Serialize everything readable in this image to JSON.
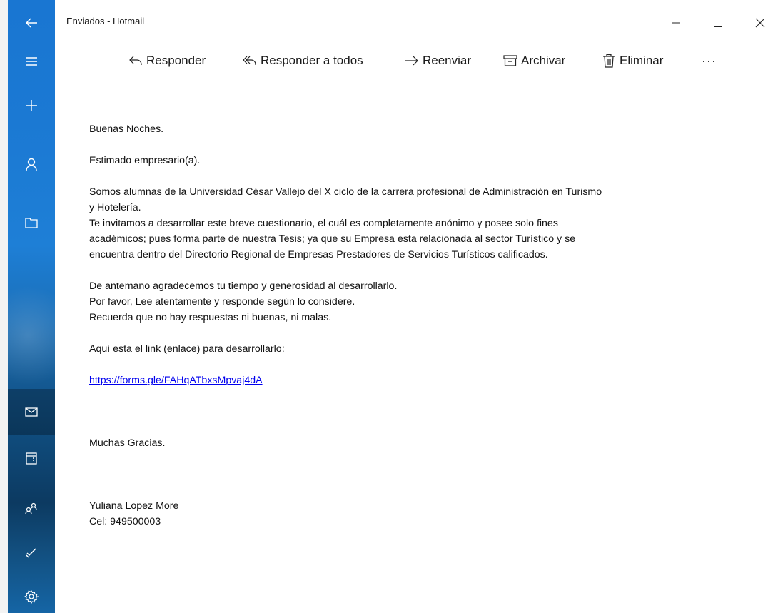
{
  "window": {
    "title": "Enviados - Hotmail"
  },
  "sidebar": {
    "items": [
      {
        "icon": "back-arrow-icon"
      },
      {
        "icon": "hamburger-menu-icon"
      },
      {
        "icon": "plus-icon"
      },
      {
        "icon": "person-icon"
      },
      {
        "icon": "folder-icon"
      },
      {
        "icon": "mail-icon"
      },
      {
        "icon": "calendar-icon"
      },
      {
        "icon": "people-icon"
      },
      {
        "icon": "todo-check-icon"
      },
      {
        "icon": "gear-icon"
      }
    ]
  },
  "toolbar": {
    "reply": "Responder",
    "reply_all": "Responder a todos",
    "forward": "Reenviar",
    "archive": "Archivar",
    "delete": "Eliminar",
    "more": "···"
  },
  "message": {
    "greeting": "Buenas Noches.",
    "salutation": "Estimado empresario(a).",
    "para1_line1": "Somos alumnas de la Universidad César Vallejo del X ciclo de la carrera profesional de Administración en Turismo",
    "para1_line2": "y Hotelería.",
    "para1_line3": "Te invitamos a desarrollar este breve cuestionario, el cuál es completamente anónimo y posee solo fines",
    "para1_line4": "académicos; pues forma parte de nuestra Tesis; ya que su Empresa esta relacionada al sector Turístico y se",
    "para1_line5": "encuentra dentro del Directorio Regional de Empresas Prestadores de Servicios Turísticos calificados.",
    "para2_line1": "De antemano agradecemos tu tiempo y generosidad al desarrollarlo.",
    "para2_line2": "Por favor, Lee atentamente y responde según lo considere.",
    "para2_line3": "Recuerda que no hay respuestas ni buenas, ni malas.",
    "link_intro": "Aquí esta el link (enlace) para desarrollarlo:",
    "link": "https://forms.gle/FAHqATbxsMpvaj4dA",
    "thanks": "Muchas Gracias.",
    "signature_name": "Yuliana Lopez More",
    "signature_phone": "Cel: 949500003"
  }
}
